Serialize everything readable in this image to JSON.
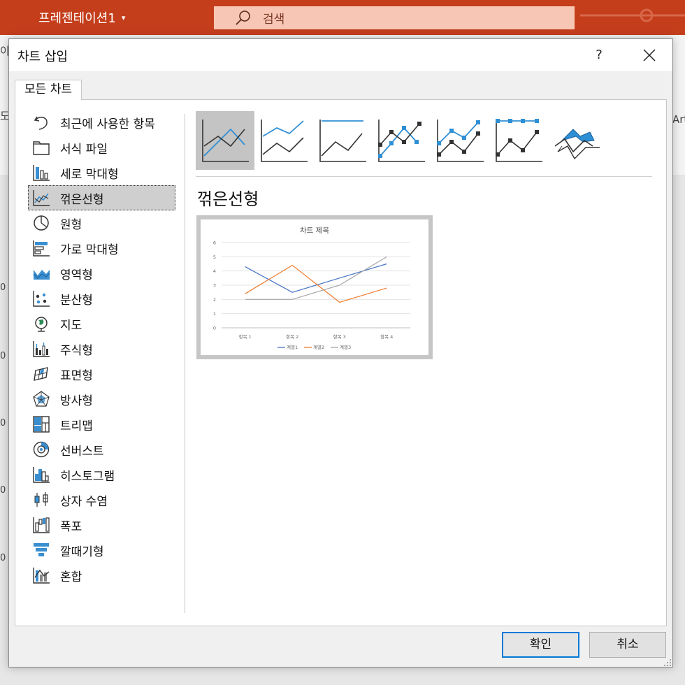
{
  "app": {
    "title": "프레젠테이션1",
    "title_caret": "▾",
    "search_placeholder": "검색",
    "accent_color": "#c43e1c",
    "left_fragment_top": "이",
    "left_fragment_mid": "도",
    "right_fragment": "Art",
    "axis_fragments": [
      "0",
      "0",
      "0",
      "0",
      "0"
    ]
  },
  "dialog": {
    "title": "차트 삽입",
    "help_label": "?",
    "close_icon": "close-icon",
    "tab_label": "모든 차트",
    "chart_types": [
      {
        "label": "최근에 사용한 항목",
        "icon": "recent-icon"
      },
      {
        "label": "서식 파일",
        "icon": "folder-icon"
      },
      {
        "label": "세로 막대형",
        "icon": "column-chart-icon"
      },
      {
        "label": "꺾은선형",
        "icon": "line-chart-icon",
        "selected": true
      },
      {
        "label": "원형",
        "icon": "pie-chart-icon"
      },
      {
        "label": "가로 막대형",
        "icon": "bar-chart-icon"
      },
      {
        "label": "영역형",
        "icon": "area-chart-icon"
      },
      {
        "label": "분산형",
        "icon": "scatter-chart-icon"
      },
      {
        "label": "지도",
        "icon": "map-chart-icon"
      },
      {
        "label": "주식형",
        "icon": "stock-chart-icon"
      },
      {
        "label": "표면형",
        "icon": "surface-chart-icon"
      },
      {
        "label": "방사형",
        "icon": "radar-chart-icon"
      },
      {
        "label": "트리맵",
        "icon": "treemap-chart-icon"
      },
      {
        "label": "선버스트",
        "icon": "sunburst-chart-icon"
      },
      {
        "label": "히스토그램",
        "icon": "histogram-chart-icon"
      },
      {
        "label": "상자 수염",
        "icon": "box-whisker-chart-icon"
      },
      {
        "label": "폭포",
        "icon": "waterfall-chart-icon"
      },
      {
        "label": "깔때기형",
        "icon": "funnel-chart-icon"
      },
      {
        "label": "혼합",
        "icon": "combo-chart-icon"
      }
    ],
    "subtypes": [
      {
        "icon": "line-subtype-icon",
        "selected": true
      },
      {
        "icon": "stacked-line-subtype-icon"
      },
      {
        "icon": "100-stacked-line-subtype-icon"
      },
      {
        "icon": "line-with-markers-subtype-icon"
      },
      {
        "icon": "stacked-line-markers-subtype-icon"
      },
      {
        "icon": "100-stacked-line-markers-subtype-icon"
      },
      {
        "icon": "3d-line-subtype-icon"
      }
    ],
    "selected_type_heading": "꺾은선형",
    "ok_label": "확인",
    "cancel_label": "취소",
    "selection_color": "#0078d7"
  },
  "chart_data": {
    "type": "line",
    "title": "차트 제목",
    "categories": [
      "항목 1",
      "항목 2",
      "항목 3",
      "항목 4"
    ],
    "series": [
      {
        "name": "계열1",
        "values": [
          4.3,
          2.5,
          3.5,
          4.5
        ],
        "color": "#4472c4"
      },
      {
        "name": "계열2",
        "values": [
          2.4,
          4.4,
          1.8,
          2.8
        ],
        "color": "#ed7d31"
      },
      {
        "name": "계열3",
        "values": [
          2,
          2,
          3,
          5
        ],
        "color": "#a5a5a5"
      }
    ],
    "ylim": [
      0,
      6
    ],
    "yticks": [
      "0",
      "1",
      "2",
      "3",
      "4",
      "5",
      "6"
    ],
    "grid": true,
    "legend_position": "bottom"
  }
}
